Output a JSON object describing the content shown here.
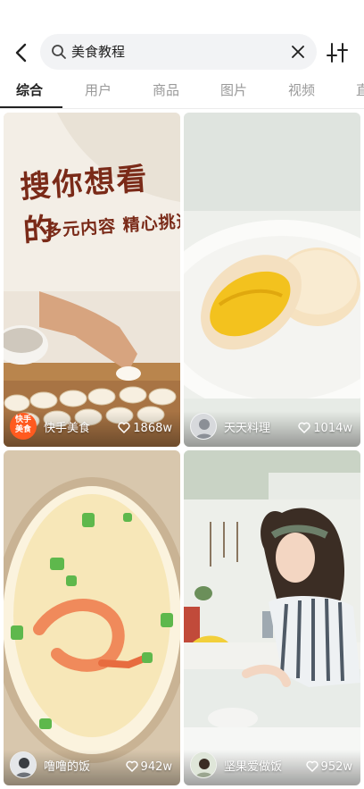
{
  "search": {
    "query": "美食教程"
  },
  "tabs": [
    {
      "label": "综合",
      "active": true
    },
    {
      "label": "用户"
    },
    {
      "label": "商品"
    },
    {
      "label": "图片"
    },
    {
      "label": "视频"
    },
    {
      "label": "直"
    }
  ],
  "cards": [
    {
      "author": "快手美食",
      "likes": "1868w",
      "overlay_title": "搜你想看的",
      "overlay_subtitle": "多元内容 精心挑选",
      "badge_line1": "快手",
      "badge_line2": "美食",
      "accent": "#ff5a1f"
    },
    {
      "author": "天天料理",
      "likes": "1014w"
    },
    {
      "author": "噜噜的饭",
      "likes": "942w"
    },
    {
      "author": "坚果爱做饭",
      "likes": "952w"
    }
  ],
  "icons": [
    "back-arrow-icon",
    "search-icon",
    "clear-x-icon",
    "filter-sliders-icon",
    "heart-icon"
  ]
}
